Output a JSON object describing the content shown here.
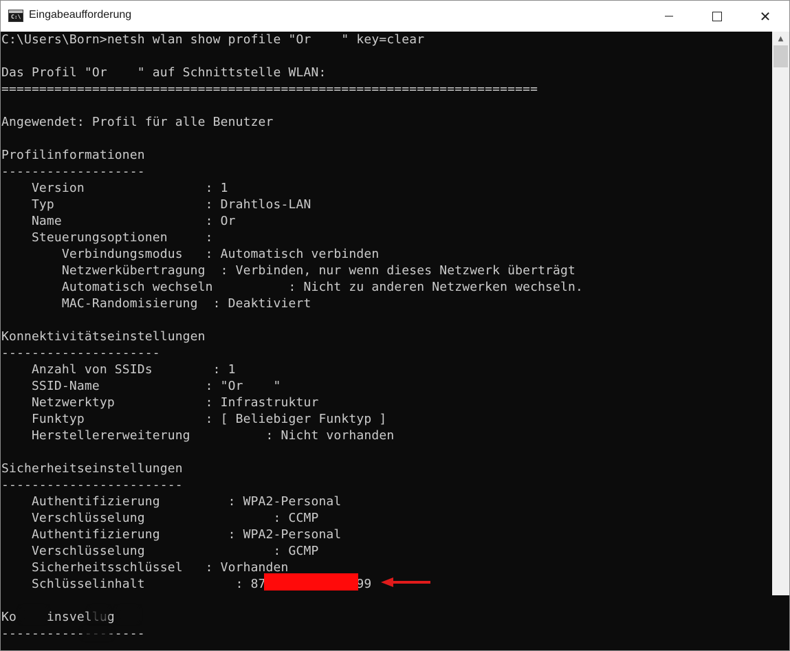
{
  "window": {
    "title": "Eingabeaufforderung",
    "icon": "cmd-icon",
    "icon_text": "C:\\",
    "controls": [
      "minimize-icon",
      "maximize-icon",
      "close-icon"
    ],
    "close_glyph": "✕"
  },
  "console": {
    "lines": [
      "C:\\Users\\Born>netsh wlan show profile \"Or    \" key=clear",
      "",
      "Das Profil \"Or    \" auf Schnittstelle WLAN:",
      "=======================================================================",
      "",
      "Angewendet: Profil für alle Benutzer",
      "",
      "Profilinformationen",
      "-------------------",
      "    Version                : 1",
      "    Typ                    : Drahtlos-LAN",
      "    Name                   : Or",
      "    Steuerungsoptionen     :",
      "        Verbindungsmodus   : Automatisch verbinden",
      "        Netzwerkübertragung  : Verbinden, nur wenn dieses Netzwerk überträgt",
      "        Automatisch wechseln          : Nicht zu anderen Netzwerken wechseln.",
      "        MAC-Randomisierung  : Deaktiviert",
      "",
      "Konnektivitätseinstellungen",
      "---------------------",
      "    Anzahl von SSIDs        : 1",
      "    SSID-Name              : \"Or    \"",
      "    Netzwerktyp            : Infrastruktur",
      "    Funktyp                : [ Beliebiger Funktyp ]",
      "    Herstellererweiterung          : Nicht vorhanden",
      "",
      "Sicherheitseinstellungen",
      "------------------------",
      "    Authentifizierung         : WPA2-Personal",
      "    Verschlüsselung                 : CCMP",
      "    Authentifizierung         : WPA2-Personal",
      "    Verschlüsselung                 : GCMP",
      "    Sicherheitsschlüssel   : Vorhanden",
      "    Schlüsselinhalt            : 87            99",
      "",
      "Ko    insvellug",
      "-------------------"
    ]
  },
  "annotation": {
    "redaction_color": "#ff0a0a",
    "arrow_color": "#e01b1b"
  },
  "scrollbar": {
    "up_glyph": "▲"
  }
}
